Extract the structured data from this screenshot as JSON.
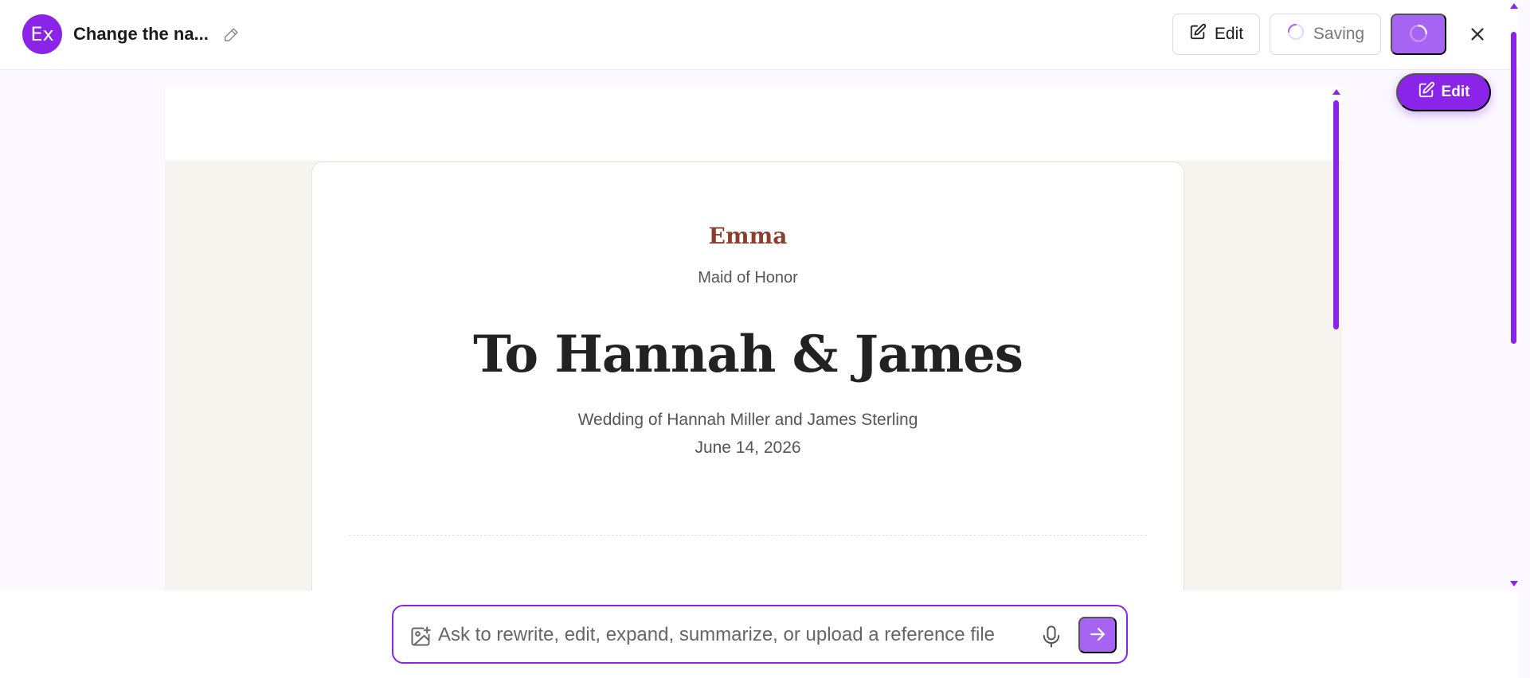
{
  "header": {
    "avatar_initials": "Ex",
    "doc_title": "Change the na...",
    "edit_label": "Edit",
    "saving_label": "Saving"
  },
  "floating": {
    "edit_label": "Edit"
  },
  "document": {
    "speaker_name": "Emma",
    "speaker_role": "Maid of Honor",
    "title": "To Hannah & James",
    "wedding_line": "Wedding of Hannah Miller and James Sterling",
    "date": "June 14, 2026"
  },
  "prompt": {
    "placeholder": "Ask to rewrite, edit, expand, summarize, or upload a reference file"
  },
  "colors": {
    "accent": "#8a24e8",
    "accent_light": "#a764f2",
    "speaker_name": "#8b3f2c"
  },
  "icons": [
    "pencil-icon",
    "edit-icon",
    "spinner-icon",
    "close-icon",
    "image-upload-icon",
    "microphone-icon",
    "arrow-right-icon"
  ]
}
